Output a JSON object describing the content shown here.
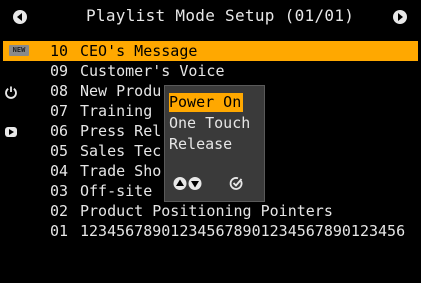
{
  "header": {
    "title": "Playlist Mode Setup (01/01)",
    "prev_icon": "circle-left-icon",
    "next_icon": "circle-right-icon"
  },
  "playlist": {
    "items": [
      {
        "number": "10",
        "label": "CEO's Message",
        "selected": true,
        "badge": "NEW"
      },
      {
        "number": "09",
        "label": "Customer's Voice"
      },
      {
        "number": "08",
        "label": "New Produ"
      },
      {
        "number": "07",
        "label": "Training"
      },
      {
        "number": "06",
        "label": "Press Rel"
      },
      {
        "number": "05",
        "label": "Sales Tec"
      },
      {
        "number": "04",
        "label": "Trade Sho"
      },
      {
        "number": "03",
        "label": "Off-site"
      },
      {
        "number": "02",
        "label": "Product Positioning Pointers"
      },
      {
        "number": "01",
        "label": "123456789012345678901234567890123456"
      }
    ]
  },
  "popup": {
    "options": [
      {
        "label": "Power On",
        "active": true
      },
      {
        "label": "One Touch"
      },
      {
        "label": "Release"
      }
    ],
    "nav_icon": "up-down-arrows-icon",
    "confirm_icon": "confirm-icon"
  },
  "colors": {
    "highlight": "#ffa800",
    "background": "#000000",
    "text": "#e6e6e6",
    "popup_bg": "#3a3a3a"
  }
}
